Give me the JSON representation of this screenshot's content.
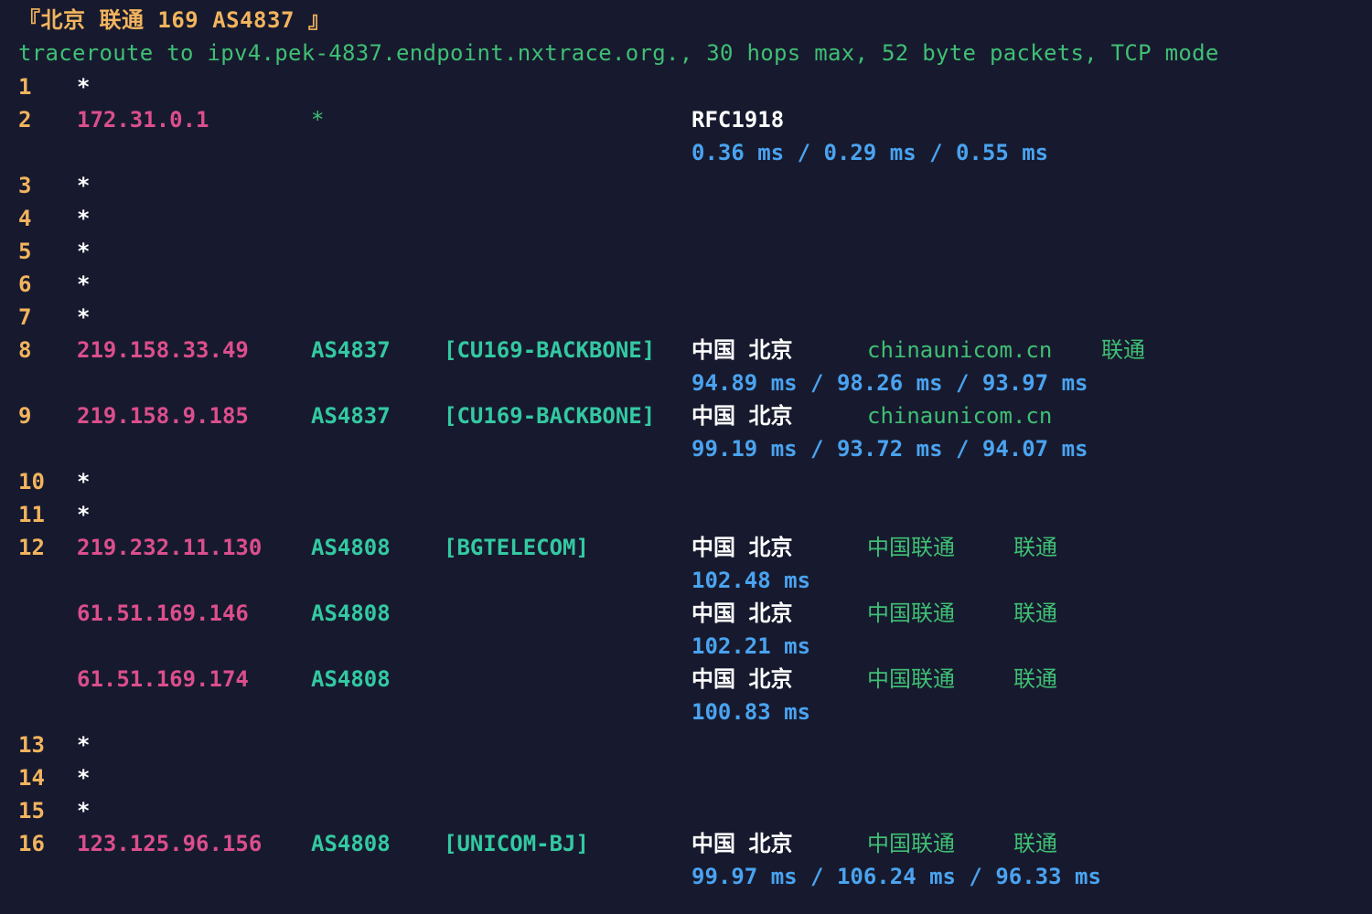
{
  "header": {
    "title": "『北京 联通 169 AS4837 』",
    "command": "traceroute to ipv4.pek-4837.endpoint.nxtrace.org., 30 hops max, 52 byte packets, TCP mode"
  },
  "hops": [
    {
      "hop": "1",
      "star": "*"
    },
    {
      "hop": "2",
      "ip": "172.31.0.1",
      "asn": "*",
      "geo": "RFC1918",
      "rtt": "0.36 ms / 0.29 ms / 0.55 ms"
    },
    {
      "hop": "3",
      "star": "*"
    },
    {
      "hop": "4",
      "star": "*"
    },
    {
      "hop": "5",
      "star": "*"
    },
    {
      "hop": "6",
      "star": "*"
    },
    {
      "hop": "7",
      "star": "*"
    },
    {
      "hop": "8",
      "ip": "219.158.33.49",
      "asn": "AS4837",
      "tag": "[CU169-BACKBONE]",
      "geo": "中国 北京",
      "domain": "chinaunicom.cn",
      "isp": "联通",
      "rtt": "94.89 ms / 98.26 ms / 93.97 ms"
    },
    {
      "hop": "9",
      "ip": "219.158.9.185",
      "asn": "AS4837",
      "tag": "[CU169-BACKBONE]",
      "geo": "中国 北京",
      "domain": "chinaunicom.cn",
      "rtt": "99.19 ms / 93.72 ms / 94.07 ms"
    },
    {
      "hop": "10",
      "star": "*"
    },
    {
      "hop": "11",
      "star": "*"
    },
    {
      "hop": "12",
      "entries": [
        {
          "ip": "219.232.11.130",
          "asn": "AS4808",
          "tag": "[BGTELECOM]",
          "geo": "中国 北京",
          "org": "中国联通",
          "isp": "联通",
          "rtt": "102.48 ms"
        },
        {
          "ip": "61.51.169.146",
          "asn": "AS4808",
          "geo": "中国 北京",
          "org": "中国联通",
          "isp": "联通",
          "rtt": "102.21 ms"
        },
        {
          "ip": "61.51.169.174",
          "asn": "AS4808",
          "geo": "中国 北京",
          "org": "中国联通",
          "isp": "联通",
          "rtt": "100.83 ms"
        }
      ]
    },
    {
      "hop": "13",
      "star": "*"
    },
    {
      "hop": "14",
      "star": "*"
    },
    {
      "hop": "15",
      "star": "*"
    },
    {
      "hop": "16",
      "ip": "123.125.96.156",
      "asn": "AS4808",
      "tag": "[UNICOM-BJ]",
      "geo": "中国 北京",
      "org": "中国联通",
      "isp": "联通",
      "rtt": "99.97 ms / 106.24 ms / 96.33 ms"
    }
  ],
  "colors": {
    "background": "#171a2e",
    "hop_number": "#f2b45e",
    "ip": "#dc4e8c",
    "asn": "#33c9a2",
    "geo": "#ffffff",
    "isp": "#3fbf74",
    "rtt": "#4aa3f0"
  }
}
